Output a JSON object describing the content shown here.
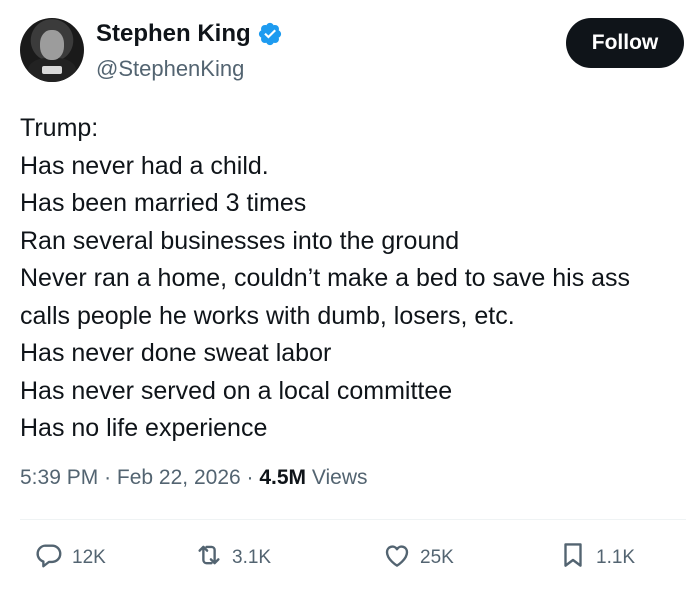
{
  "author": {
    "name": "Stephen King",
    "handle": "@StephenKing",
    "verified_icon": "verified-badge-icon",
    "verified_color": "#1d9bf0"
  },
  "follow_label": "Follow",
  "tweet": {
    "lines": [
      "Trump:",
      "Has never had a child.",
      "Has been married 3 times",
      "Ran several businesses into the ground",
      "Never ran a home, couldn’t make a bed to save his ass",
      "calls people he works with dumb, losers, etc.",
      "Has never done sweat labor",
      "Has never served on a local committee",
      "Has no life experience"
    ]
  },
  "meta": {
    "time": "5:39 PM",
    "separator": "·",
    "date": "Feb 22, 2026",
    "views_count": "4.5M",
    "views_label": "Views"
  },
  "actions": {
    "replies": "12K",
    "reposts": "3.1K",
    "likes": "25K",
    "bookmarks": "1.1K"
  },
  "colors": {
    "text": "#0f1419",
    "secondary": "#536471",
    "button_bg": "#0f1419",
    "button_text": "#ffffff"
  }
}
